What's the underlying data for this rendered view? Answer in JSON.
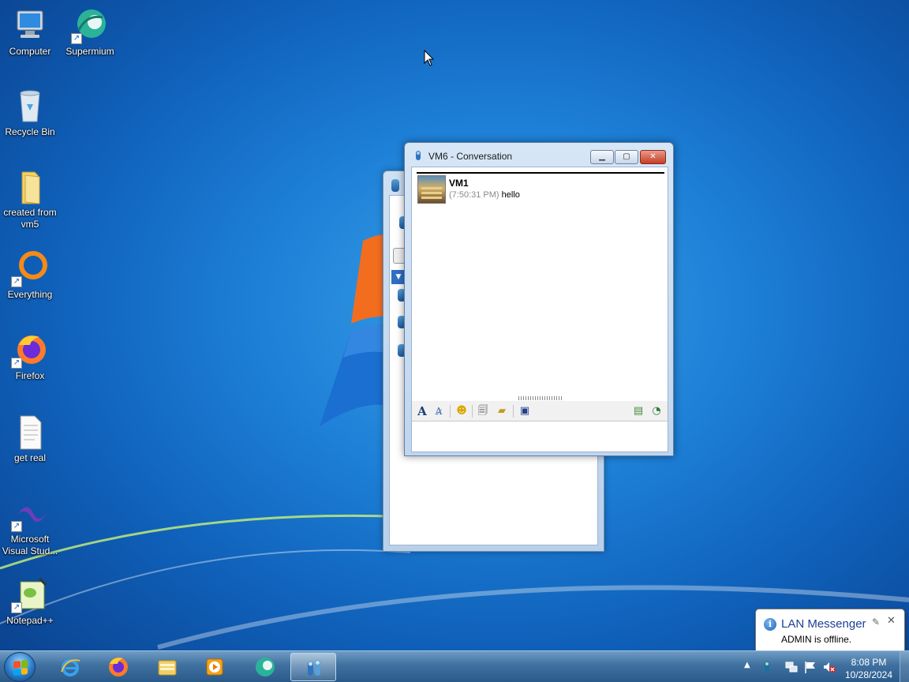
{
  "desktop": {
    "icons": [
      {
        "label": "Computer",
        "icon": "computer-icon",
        "shortcut": false
      },
      {
        "label": "Supermium",
        "icon": "supermium-icon",
        "shortcut": true
      },
      {
        "label": "Recycle Bin",
        "icon": "recycle-bin-icon",
        "shortcut": false
      },
      {
        "label": "created from vm5",
        "icon": "folder-icon",
        "shortcut": false
      },
      {
        "label": "Everything",
        "icon": "everything-icon",
        "shortcut": true
      },
      {
        "label": "Firefox",
        "icon": "firefox-icon",
        "shortcut": true
      },
      {
        "label": "get real",
        "icon": "text-file-icon",
        "shortcut": false
      },
      {
        "label": "Microsoft Visual Stud...",
        "icon": "visual-studio-icon",
        "shortcut": true
      },
      {
        "label": "Notepad++",
        "icon": "notepad-plus-plus-icon",
        "shortcut": true
      }
    ]
  },
  "conversation": {
    "title": "VM6 - Conversation",
    "messages": [
      {
        "sender": "VM1",
        "time": "(7:50:31 PM)",
        "text": "hello"
      }
    ],
    "toolbar": [
      "font-icon",
      "font-style-icon",
      "smiley-icon",
      "file-transfer-icon",
      "folder-share-icon",
      "save-icon",
      "history-icon",
      "broadcast-icon"
    ],
    "input_value": ""
  },
  "notification": {
    "title": "LAN Messenger",
    "text": "ADMIN is offline."
  },
  "taskbar": {
    "pinned": [
      "internet-explorer-icon",
      "firefox-icon",
      "file-explorer-icon",
      "media-player-icon",
      "supermium-icon",
      "lan-messenger-icon"
    ],
    "active": "lan-messenger-icon",
    "tray": [
      "lan-messenger-tray-icon",
      "network-icon",
      "action-center-flag-icon",
      "volume-muted-icon"
    ],
    "time": "8:08 PM",
    "date": "10/28/2024"
  },
  "colors": {
    "desktop_blue": "#1d7fd6",
    "taskbar": "#3f70a0",
    "balloon_title": "#1c3f94",
    "close_button": "#c63d26"
  }
}
